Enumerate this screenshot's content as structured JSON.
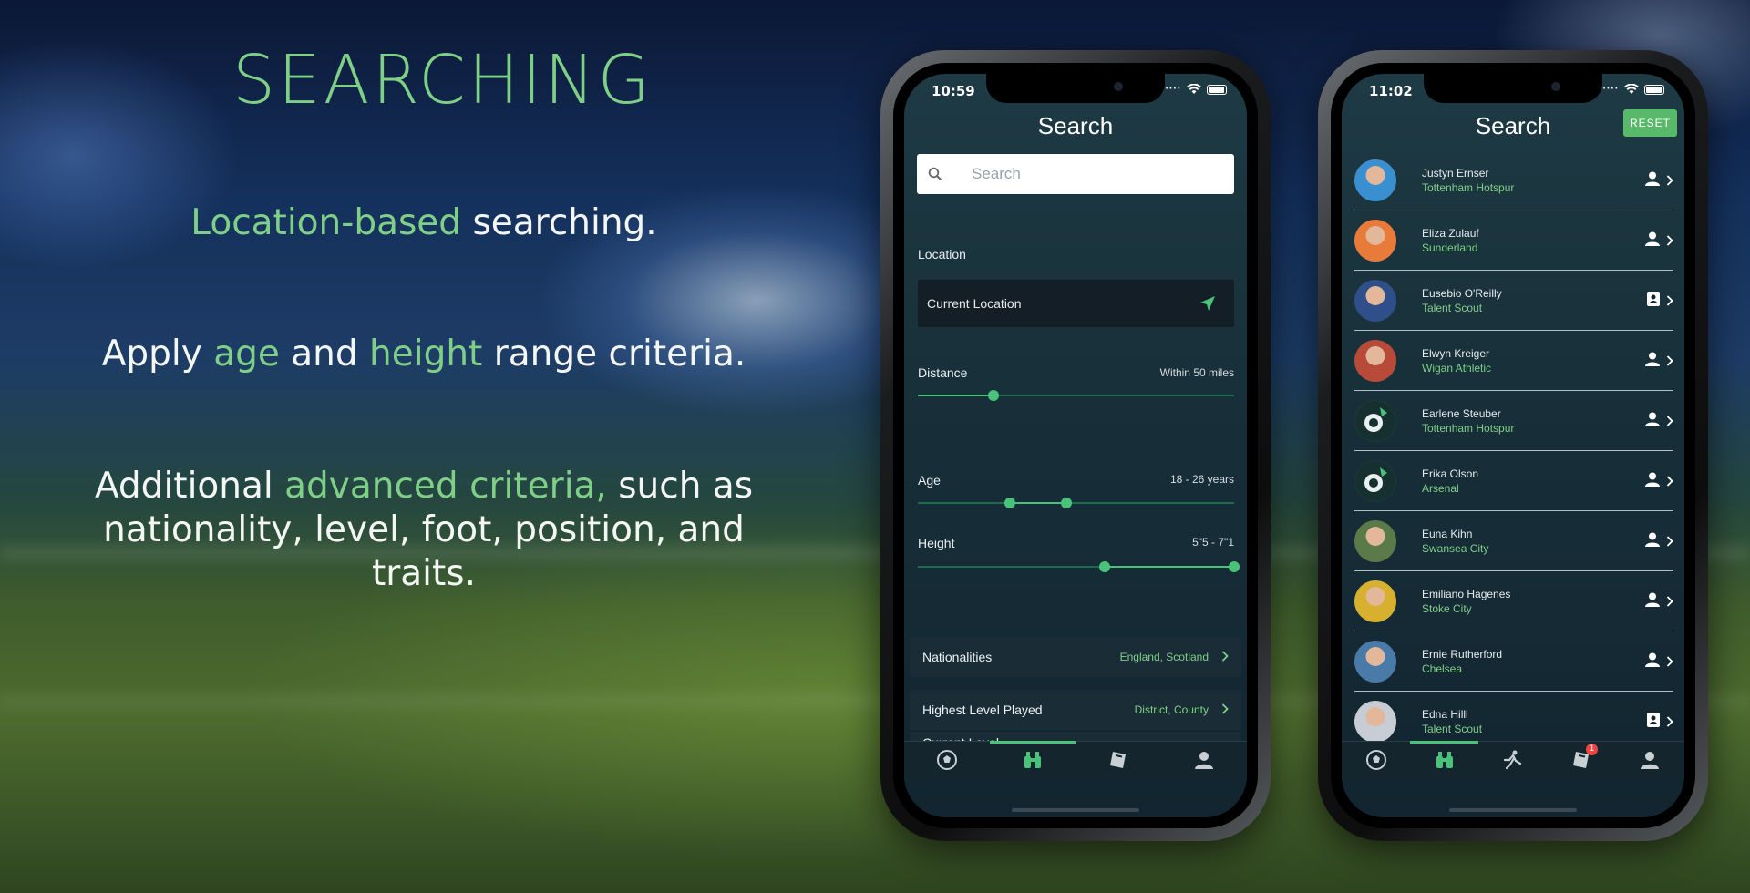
{
  "title": "SEARCHING",
  "captions": {
    "line1": {
      "hl": "Location-based",
      "rest": " searching."
    },
    "line2": {
      "a": "Apply ",
      "hl1": "age",
      "b": " and ",
      "hl2": "height",
      "c": " range criteria."
    },
    "line3": {
      "a": "Additional ",
      "hl": "advanced criteria,",
      "b": " such as nationality, level, foot, position, and traits."
    }
  },
  "phone1": {
    "time": "10:59",
    "nav_title": "Search",
    "search_placeholder": "Search",
    "location_label": "Location",
    "location_value": "Current Location",
    "distance_label": "Distance",
    "distance_value": "Within 50 miles",
    "distance_fraction": 0.24,
    "age_label": "Age",
    "age_value": "18 - 26 years",
    "age_range_fraction": [
      0.29,
      0.47
    ],
    "height_label": "Height",
    "height_value": "5\"5 - 7\"1",
    "height_range_fraction": [
      0.59,
      1.0
    ],
    "rows": [
      {
        "label": "Nationalities",
        "value": "England, Scotland"
      },
      {
        "label": "Highest Level Played",
        "value": "District, County"
      },
      {
        "label": "Current Level",
        "value": ""
      }
    ],
    "tabs": [
      "ball-icon",
      "binoculars-icon",
      "ticket-icon",
      "profile-icon"
    ],
    "active_tab": 1
  },
  "phone2": {
    "time": "11:02",
    "nav_title": "Search",
    "reset_label": "RESET",
    "notification_count": "1",
    "players": [
      {
        "name": "Justyn Ernser",
        "club": "Tottenham Hotspur",
        "type": "person",
        "avatar": "#3a8fd0"
      },
      {
        "name": "Eliza Zulauf",
        "club": "Sunderland",
        "type": "person",
        "avatar": "#e87a3a"
      },
      {
        "name": "Eusebio O'Reilly",
        "club": "Talent Scout",
        "type": "scout",
        "avatar": "#2f4f8a"
      },
      {
        "name": "Elwyn Kreiger",
        "club": "Wigan Athletic",
        "type": "person",
        "avatar": "#b84a3a"
      },
      {
        "name": "Earlene Steuber",
        "club": "Tottenham Hotspur",
        "type": "person",
        "avatar": "logo"
      },
      {
        "name": "Erika Olson",
        "club": "Arsenal",
        "type": "person",
        "avatar": "logo"
      },
      {
        "name": "Euna Kihn",
        "club": "Swansea City",
        "type": "person",
        "avatar": "#5a7a4a"
      },
      {
        "name": "Emiliano Hagenes",
        "club": "Stoke City",
        "type": "person",
        "avatar": "#d8b030"
      },
      {
        "name": "Ernie Rutherford",
        "club": "Chelsea",
        "type": "person",
        "avatar": "#4a7aa8"
      },
      {
        "name": "Edna Hilll",
        "club": "Talent Scout",
        "type": "scout",
        "avatar": "#c8ccd4"
      }
    ],
    "tabs": [
      "ball-icon",
      "binoculars-icon",
      "player-icon",
      "ticket-icon",
      "profile-icon"
    ],
    "active_tab": 1
  }
}
